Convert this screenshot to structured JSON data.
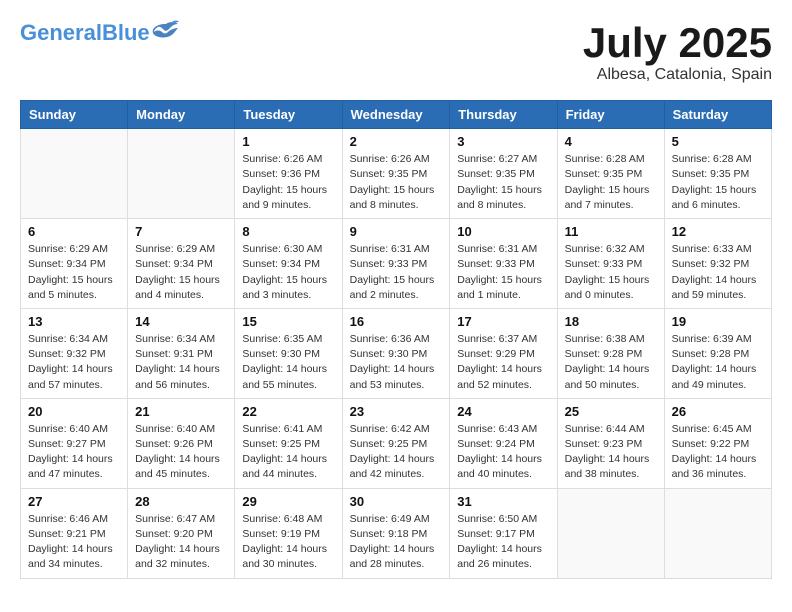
{
  "logo": {
    "general": "General",
    "blue": "Blue"
  },
  "header": {
    "month_year": "July 2025",
    "location": "Albesa, Catalonia, Spain"
  },
  "days_of_week": [
    "Sunday",
    "Monday",
    "Tuesday",
    "Wednesday",
    "Thursday",
    "Friday",
    "Saturday"
  ],
  "weeks": [
    [
      {
        "day": "",
        "info": ""
      },
      {
        "day": "",
        "info": ""
      },
      {
        "day": "1",
        "info": "Sunrise: 6:26 AM\nSunset: 9:36 PM\nDaylight: 15 hours\nand 9 minutes."
      },
      {
        "day": "2",
        "info": "Sunrise: 6:26 AM\nSunset: 9:35 PM\nDaylight: 15 hours\nand 8 minutes."
      },
      {
        "day": "3",
        "info": "Sunrise: 6:27 AM\nSunset: 9:35 PM\nDaylight: 15 hours\nand 8 minutes."
      },
      {
        "day": "4",
        "info": "Sunrise: 6:28 AM\nSunset: 9:35 PM\nDaylight: 15 hours\nand 7 minutes."
      },
      {
        "day": "5",
        "info": "Sunrise: 6:28 AM\nSunset: 9:35 PM\nDaylight: 15 hours\nand 6 minutes."
      }
    ],
    [
      {
        "day": "6",
        "info": "Sunrise: 6:29 AM\nSunset: 9:34 PM\nDaylight: 15 hours\nand 5 minutes."
      },
      {
        "day": "7",
        "info": "Sunrise: 6:29 AM\nSunset: 9:34 PM\nDaylight: 15 hours\nand 4 minutes."
      },
      {
        "day": "8",
        "info": "Sunrise: 6:30 AM\nSunset: 9:34 PM\nDaylight: 15 hours\nand 3 minutes."
      },
      {
        "day": "9",
        "info": "Sunrise: 6:31 AM\nSunset: 9:33 PM\nDaylight: 15 hours\nand 2 minutes."
      },
      {
        "day": "10",
        "info": "Sunrise: 6:31 AM\nSunset: 9:33 PM\nDaylight: 15 hours\nand 1 minute."
      },
      {
        "day": "11",
        "info": "Sunrise: 6:32 AM\nSunset: 9:33 PM\nDaylight: 15 hours\nand 0 minutes."
      },
      {
        "day": "12",
        "info": "Sunrise: 6:33 AM\nSunset: 9:32 PM\nDaylight: 14 hours\nand 59 minutes."
      }
    ],
    [
      {
        "day": "13",
        "info": "Sunrise: 6:34 AM\nSunset: 9:32 PM\nDaylight: 14 hours\nand 57 minutes."
      },
      {
        "day": "14",
        "info": "Sunrise: 6:34 AM\nSunset: 9:31 PM\nDaylight: 14 hours\nand 56 minutes."
      },
      {
        "day": "15",
        "info": "Sunrise: 6:35 AM\nSunset: 9:30 PM\nDaylight: 14 hours\nand 55 minutes."
      },
      {
        "day": "16",
        "info": "Sunrise: 6:36 AM\nSunset: 9:30 PM\nDaylight: 14 hours\nand 53 minutes."
      },
      {
        "day": "17",
        "info": "Sunrise: 6:37 AM\nSunset: 9:29 PM\nDaylight: 14 hours\nand 52 minutes."
      },
      {
        "day": "18",
        "info": "Sunrise: 6:38 AM\nSunset: 9:28 PM\nDaylight: 14 hours\nand 50 minutes."
      },
      {
        "day": "19",
        "info": "Sunrise: 6:39 AM\nSunset: 9:28 PM\nDaylight: 14 hours\nand 49 minutes."
      }
    ],
    [
      {
        "day": "20",
        "info": "Sunrise: 6:40 AM\nSunset: 9:27 PM\nDaylight: 14 hours\nand 47 minutes."
      },
      {
        "day": "21",
        "info": "Sunrise: 6:40 AM\nSunset: 9:26 PM\nDaylight: 14 hours\nand 45 minutes."
      },
      {
        "day": "22",
        "info": "Sunrise: 6:41 AM\nSunset: 9:25 PM\nDaylight: 14 hours\nand 44 minutes."
      },
      {
        "day": "23",
        "info": "Sunrise: 6:42 AM\nSunset: 9:25 PM\nDaylight: 14 hours\nand 42 minutes."
      },
      {
        "day": "24",
        "info": "Sunrise: 6:43 AM\nSunset: 9:24 PM\nDaylight: 14 hours\nand 40 minutes."
      },
      {
        "day": "25",
        "info": "Sunrise: 6:44 AM\nSunset: 9:23 PM\nDaylight: 14 hours\nand 38 minutes."
      },
      {
        "day": "26",
        "info": "Sunrise: 6:45 AM\nSunset: 9:22 PM\nDaylight: 14 hours\nand 36 minutes."
      }
    ],
    [
      {
        "day": "27",
        "info": "Sunrise: 6:46 AM\nSunset: 9:21 PM\nDaylight: 14 hours\nand 34 minutes."
      },
      {
        "day": "28",
        "info": "Sunrise: 6:47 AM\nSunset: 9:20 PM\nDaylight: 14 hours\nand 32 minutes."
      },
      {
        "day": "29",
        "info": "Sunrise: 6:48 AM\nSunset: 9:19 PM\nDaylight: 14 hours\nand 30 minutes."
      },
      {
        "day": "30",
        "info": "Sunrise: 6:49 AM\nSunset: 9:18 PM\nDaylight: 14 hours\nand 28 minutes."
      },
      {
        "day": "31",
        "info": "Sunrise: 6:50 AM\nSunset: 9:17 PM\nDaylight: 14 hours\nand 26 minutes."
      },
      {
        "day": "",
        "info": ""
      },
      {
        "day": "",
        "info": ""
      }
    ]
  ]
}
